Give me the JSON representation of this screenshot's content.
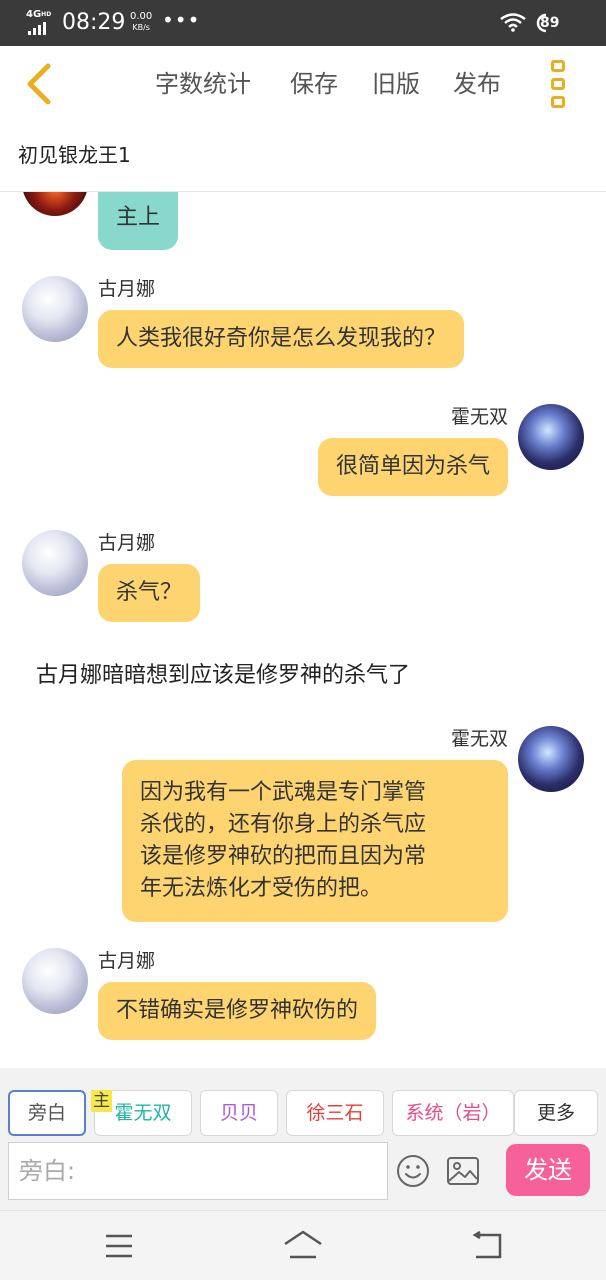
{
  "status_bar": {
    "network": "4G",
    "network_sup": "HD",
    "time": "08:29",
    "speed_value": "0.00",
    "speed_unit": "KB/s",
    "more_dots": "•••",
    "battery": "89",
    "icons": [
      "signal-icon",
      "wifi-icon",
      "battery-icon"
    ]
  },
  "toolbar": {
    "back_icon": "chevron-left-icon",
    "word_count": "字数统计",
    "save": "保存",
    "old_version": "旧版",
    "publish": "发布",
    "more_icon": "more-vertical-icon",
    "accent_color": "#e8b020"
  },
  "document": {
    "title": "初见银龙王1"
  },
  "chat": {
    "bubble_color": "#fdd470",
    "teal_color": "#88d8cc",
    "messages": [
      {
        "type": "left",
        "sender": "",
        "text": "主上",
        "style": "teal"
      },
      {
        "type": "left",
        "sender": "古月娜",
        "text": "人类我很好奇你是怎么发现我的？"
      },
      {
        "type": "right",
        "sender": "霍无双",
        "text": "很简单因为杀气"
      },
      {
        "type": "left",
        "sender": "古月娜",
        "text": "杀气？"
      },
      {
        "type": "narration",
        "text": "古月娜暗暗想到应该是修罗神的杀气了"
      },
      {
        "type": "right",
        "sender": "霍无双",
        "lines": [
          "因为我有一个武魂是专门掌管",
          "杀伐的，还有你身上的杀气应",
          "该是修罗神砍的把而且因为常",
          "年无法炼化才受伤的把。"
        ]
      },
      {
        "type": "left",
        "sender": "古月娜",
        "text": "不错确实是修罗神砍伤的"
      }
    ]
  },
  "roles": {
    "items": [
      {
        "label": "旁白",
        "color": "#555555",
        "selected": true
      },
      {
        "label": "霍无双",
        "color": "#1fb5a5",
        "badge": "主"
      },
      {
        "label": "贝贝",
        "color": "#b057d8"
      },
      {
        "label": "徐三石",
        "color": "#e0403c"
      },
      {
        "label": "系统（岩）",
        "color": "#e84d8a"
      },
      {
        "label": "更多",
        "color": "#333333"
      }
    ]
  },
  "input": {
    "placeholder": "旁白:",
    "emoji_icon": "emoji-icon",
    "image_icon": "image-icon",
    "send_label": "发送",
    "send_color": "#f7619a"
  },
  "nav": {
    "menu_icon": "menu-icon",
    "home_icon": "home-icon",
    "back_icon": "back-icon"
  }
}
